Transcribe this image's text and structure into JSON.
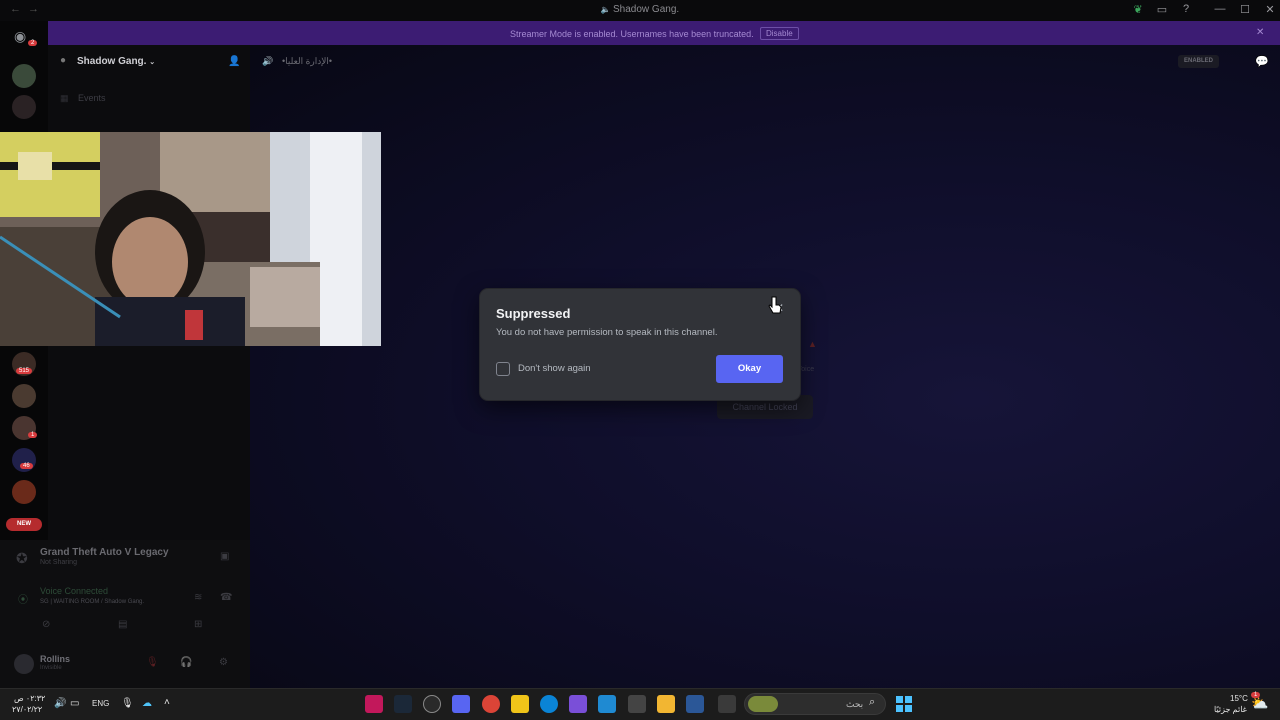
{
  "window": {
    "title": "Shadow Gang."
  },
  "banner": {
    "text": "Streamer Mode is enabled. Usernames have been truncated.",
    "button": "Disable"
  },
  "server": {
    "name": "Shadow Gang.",
    "events": "Events"
  },
  "channel": {
    "name": "•الإدارة العليا•",
    "streamer_pill": "ENABLED"
  },
  "rail": {
    "badges": [
      "2",
      "515",
      "1",
      "46"
    ],
    "new_pill": "NEW"
  },
  "activity": {
    "game": "Grand Theft Auto V Legacy",
    "status": "Not Sharing"
  },
  "voice": {
    "title": "Voice Connected",
    "channel": "SG | WAITING ROOM",
    "server": "/ Shadow Gang."
  },
  "user": {
    "name": "Rollins",
    "status": "Invisible"
  },
  "background": {
    "locked_label": "Channel Locked",
    "voice_fragment": "Voice"
  },
  "modal": {
    "title": "Suppressed",
    "body": "You do not have permission to speak in this channel.",
    "checkbox_label": "Don't show again",
    "okay_label": "Okay",
    "accent": "#5865f2"
  },
  "taskbar": {
    "time": "٠٢:٣٢ ص",
    "date": "٢٧/٠٢/٢٢",
    "language": "ENG",
    "search_placeholder": "بحث",
    "weather_temp": "15°C",
    "weather_desc": "غائم جزئيًا",
    "notification_count": "1"
  }
}
